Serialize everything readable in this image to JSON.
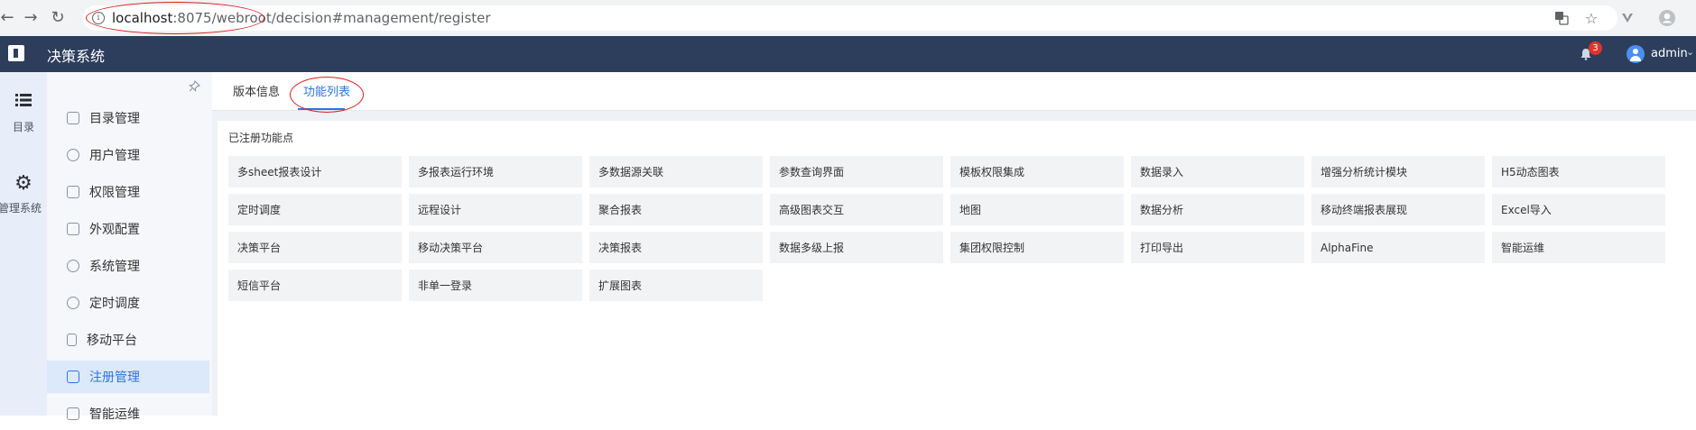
{
  "browser": {
    "url_host": "localhost",
    "url_rest": ":8075/webroot/decision#management/register",
    "icons": [
      "back-icon",
      "forward-icon",
      "reload-icon",
      "info-icon",
      "translate-icon",
      "star-icon",
      "extension-icon",
      "profile-icon"
    ]
  },
  "app": {
    "title": "决策系统",
    "notification_count": "3",
    "user_name": "admin"
  },
  "rail": {
    "items": [
      {
        "label": "目录",
        "icon": "list-icon"
      },
      {
        "label": "管理系统",
        "icon": "gear-icon"
      }
    ]
  },
  "menu": {
    "items": [
      {
        "label": "目录管理",
        "icon": "catalog-icon"
      },
      {
        "label": "用户管理",
        "icon": "user-icon"
      },
      {
        "label": "权限管理",
        "icon": "lock-icon"
      },
      {
        "label": "外观配置",
        "icon": "paint-icon"
      },
      {
        "label": "系统管理",
        "icon": "settings-icon"
      },
      {
        "label": "定时调度",
        "icon": "clock-icon"
      },
      {
        "label": "移动平台",
        "icon": "mobile-icon"
      },
      {
        "label": "注册管理",
        "icon": "register-icon",
        "active": true
      },
      {
        "label": "智能运维",
        "icon": "ops-icon"
      }
    ]
  },
  "tabs": [
    {
      "label": "版本信息"
    },
    {
      "label": "功能列表",
      "active": true
    }
  ],
  "panel": {
    "title": "已注册功能点",
    "features": [
      "多sheet报表设计",
      "多报表运行环境",
      "多数据源关联",
      "参数查询界面",
      "模板权限集成",
      "数据录入",
      "增强分析统计模块",
      "H5动态图表",
      "定时调度",
      "远程设计",
      "聚合报表",
      "高级图表交互",
      "地图",
      "数据分析",
      "移动终端报表展现",
      "Excel导入",
      "决策平台",
      "移动决策平台",
      "决策报表",
      "数据多级上报",
      "集团权限控制",
      "打印导出",
      "AlphaFine",
      "智能运维",
      "短信平台",
      "非单一登录",
      "扩展图表"
    ]
  },
  "colors": {
    "header_bg": "#2c3e5c",
    "accent": "#2f74e0",
    "annotation_red": "#d42020",
    "badge_red": "#e0342a"
  }
}
